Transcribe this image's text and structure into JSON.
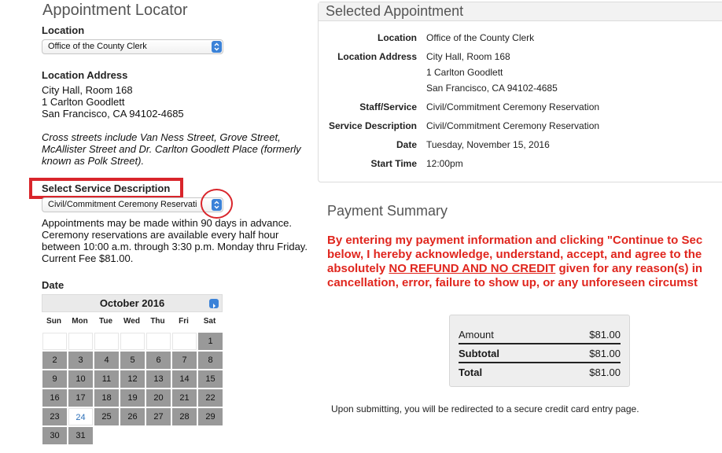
{
  "header": {
    "title": "Appointment Locator"
  },
  "location": {
    "label": "Location",
    "selected": "Office of the County Clerk"
  },
  "location_address": {
    "label": "Location Address",
    "line1": "City Hall, Room 168",
    "line2": "1 Carlton Goodlett",
    "line3": "San Francisco, CA 94102-4685",
    "cross_streets": [
      "Cross streets include Van Ness Street, Grove Street,",
      "McAllister Street and Dr. Carlton Goodlett Place (formerly",
      "known as Polk Street)."
    ]
  },
  "service": {
    "label": "Select Service Description",
    "selected": "Civil/Commitment Ceremony Reservati",
    "info": [
      "Appointments may be made within 90 days in advance.",
      "Ceremony reservations are available every half hour",
      "between 10:00 a.m. through 3:30 p.m. Monday thru Friday.",
      "Current Fee $81.00."
    ]
  },
  "date": {
    "label": "Date",
    "month": "October 2016",
    "weekdays": [
      "Sun",
      "Mon",
      "Tue",
      "Wed",
      "Thu",
      "Fri",
      "Sat"
    ],
    "days": [
      "1",
      "2",
      "3",
      "4",
      "5",
      "6",
      "7",
      "8",
      "9",
      "10",
      "11",
      "12",
      "13",
      "14",
      "15",
      "16",
      "17",
      "18",
      "19",
      "20",
      "21",
      "22",
      "23",
      "24",
      "25",
      "26",
      "27",
      "28",
      "29",
      "30",
      "31"
    ],
    "highlighted_day": "24"
  },
  "selected_appointment": {
    "title": "Selected Appointment",
    "fields": [
      {
        "key": "Location",
        "value": [
          "Office of the County Clerk"
        ]
      },
      {
        "key": "Location Address",
        "value": [
          "City Hall, Room 168",
          "1 Carlton Goodlett",
          "San Francisco, CA 94102-4685"
        ]
      },
      {
        "key": "Staff/Service",
        "value": [
          "Civil/Commitment Ceremony Reservation"
        ]
      },
      {
        "key": "Service Description",
        "value": [
          "Civil/Commitment Ceremony Reservation"
        ]
      },
      {
        "key": "Date",
        "value": [
          "Tuesday, November 15, 2016"
        ]
      },
      {
        "key": "Start Time",
        "value": [
          "12:00pm"
        ]
      }
    ]
  },
  "payment": {
    "title": "Payment Summary",
    "warning_lines": [
      "By entering my payment information and clicking \"Continue to Sec",
      "below, I hereby acknowledge, understand, accept, and agree to the",
      "absolutely ",
      " given for any reason(s) in",
      "cancellation, error, failure to show up, or any unforeseen circumst"
    ],
    "warning_emphasis": "NO REFUND AND NO CREDIT",
    "summary": {
      "amount_label": "Amount",
      "amount": "$81.00",
      "subtotal_label": "Subtotal",
      "subtotal": "$81.00",
      "total_label": "Total",
      "total": "$81.00"
    },
    "note": "Upon submitting, you will be redirected to a secure credit card entry page."
  },
  "colors": {
    "accent": "#3b82d8",
    "warning": "#e0261e",
    "annotation": "#d9252b"
  }
}
